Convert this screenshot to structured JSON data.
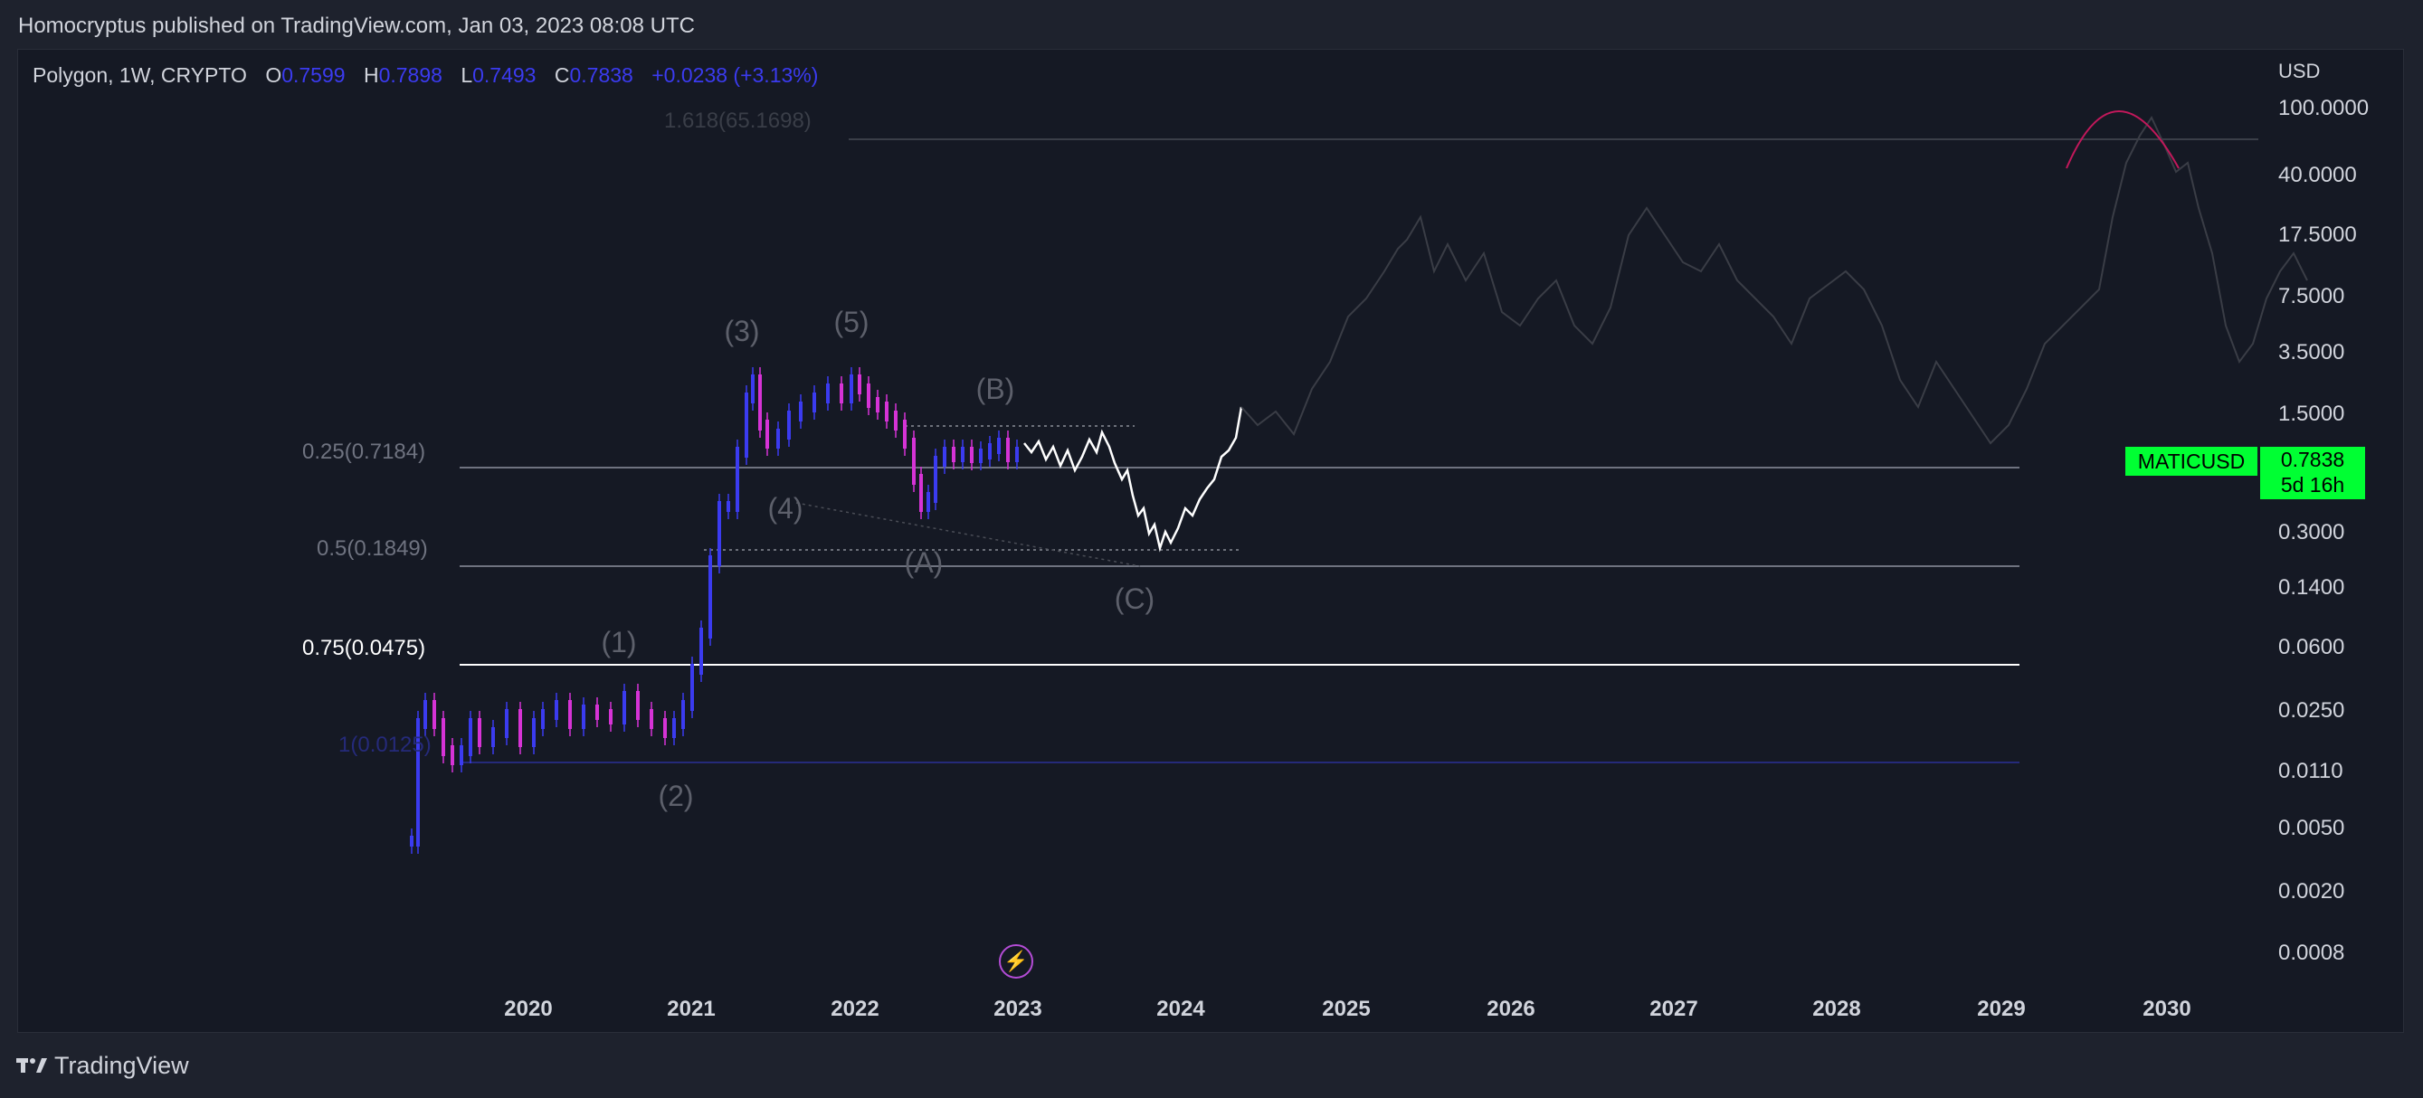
{
  "header": {
    "publisher": "Homocryptus published on TradingView.com, Jan 03, 2023 08:08 UTC"
  },
  "legend": {
    "symbol": "Polygon, 1W, CRYPTO",
    "o_label": "O",
    "o_value": "0.7599",
    "h_label": "H",
    "h_value": "0.7898",
    "l_label": "L",
    "l_value": "0.7493",
    "c_label": "C",
    "c_value": "0.7838",
    "change": "+0.0238 (+3.13%)"
  },
  "price_axis": {
    "currency": "USD",
    "ticks": [
      "100.0000",
      "40.0000",
      "17.5000",
      "7.5000",
      "3.5000",
      "1.5000",
      "0.3000",
      "0.1400",
      "0.0600",
      "0.0250",
      "0.0110",
      "0.0050",
      "0.0020",
      "0.0008"
    ]
  },
  "time_axis": {
    "ticks": [
      "2020",
      "2021",
      "2022",
      "2023",
      "2024",
      "2025",
      "2026",
      "2027",
      "2028",
      "2029",
      "2030"
    ]
  },
  "fib_levels": [
    {
      "label": "1.618(65.1698)",
      "color": "#3a3e48"
    },
    {
      "label": "0.25(0.7184)",
      "color": "#6f7380"
    },
    {
      "label": "0.5(0.1849)",
      "color": "#6f7380"
    },
    {
      "label": "0.75(0.0475)",
      "color": "#ffffff"
    },
    {
      "label": "1(0.0125)",
      "color": "#252a7a"
    }
  ],
  "wave_labels": [
    "(1)",
    "(2)",
    "(3)",
    "(4)",
    "(5)",
    "(A)",
    "(B)",
    "(C)"
  ],
  "last_price": {
    "symbol": "MATICUSD",
    "price": "0.7838",
    "countdown": "5d 16h"
  },
  "footer": {
    "brand": "TradingView"
  },
  "colors": {
    "background": "#151924",
    "up_candle": "#3b3bf0",
    "down_candle": "#d633d6",
    "badge": "#00ff33"
  },
  "icons": {
    "event_marker": "lightning-icon",
    "brand": "tradingview-logo-icon"
  }
}
